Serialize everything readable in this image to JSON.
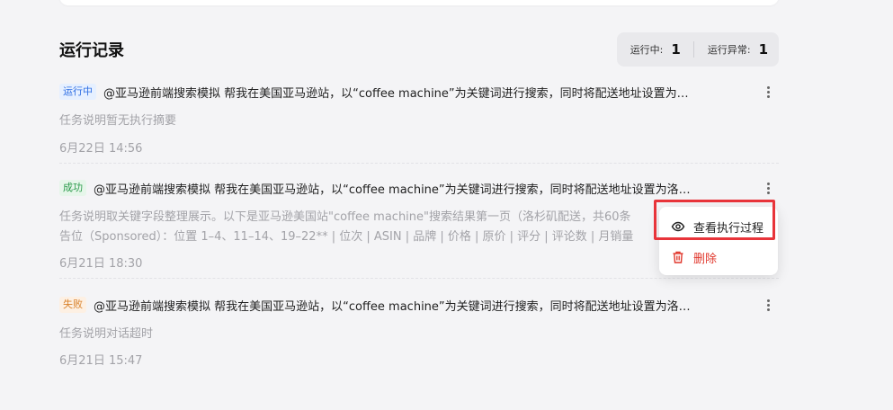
{
  "section": {
    "title": "运行记录",
    "stats": [
      {
        "label": "运行中:",
        "value": "1"
      },
      {
        "label": "运行异常:",
        "value": "1"
      }
    ]
  },
  "records": [
    {
      "status": "运行中",
      "title": "@亚马逊前端搜索模拟 帮我在美国亚马逊站，以“coffee machine”为关键词进行搜索，同时将配送地址设置为…",
      "desc_lines": [
        "任务说明暂无执行摘要"
      ],
      "date": "6月22日 14:56"
    },
    {
      "status": "成功",
      "title": "@亚马逊前端搜索模拟 帮我在美国亚马逊站，以“coffee machine”为关键词进行搜索，同时将配送地址设置为洛…",
      "desc_lines": [
        "任务说明取关键字段整理展示。以下是亚马逊美国站\"coffee machine\"搜索结果第一页（洛杉矶配送，共60条",
        "告位（Sponsored）：位置 1–4、11–14、19–22** | 位次 | ASIN | 品牌 | 价格 | 原价 | 评分 | 评论数 | 月销量"
      ],
      "date": "6月21日 18:30"
    },
    {
      "status": "失败",
      "title": "@亚马逊前端搜索模拟 帮我在美国亚马逊站，以“coffee machine”为关键词进行搜索，同时将配送地址设置为洛…",
      "desc_lines": [
        "任务说明对话超时"
      ],
      "date": "6月21日 15:47"
    }
  ],
  "context_menu": {
    "items": [
      {
        "label": "查看执行过程",
        "icon": "eye-icon"
      },
      {
        "label": "删除",
        "icon": "trash-icon"
      }
    ]
  },
  "colors": {
    "running": "#2f6fe4",
    "success": "#2a9a4a",
    "failed": "#d9822b",
    "danger": "#e0362b",
    "highlight": "#e8343a"
  }
}
